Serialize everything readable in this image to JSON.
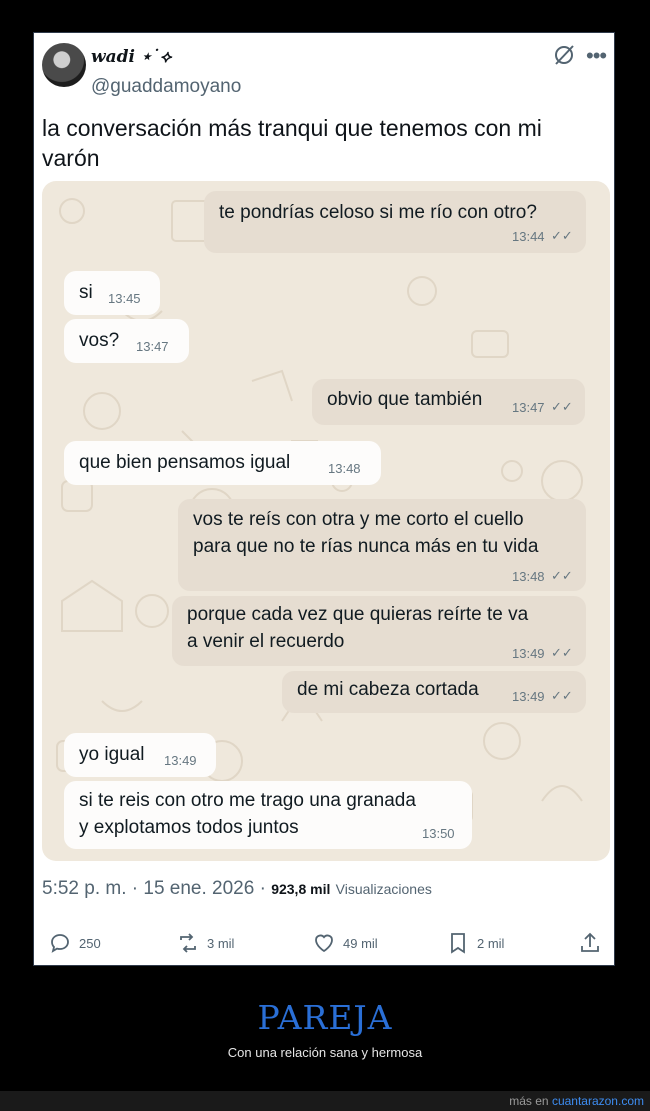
{
  "tweet": {
    "display_name": "wadi ⋆˙⟡",
    "handle": "@guaddamoyano",
    "text": "la conversación más tranqui que tenemos con mi varón",
    "timestamp": "5:52 p. m. · 15 ene. 2026 ·",
    "views_count": "923,8 mil",
    "views_label": "Visualizaciones",
    "replies": "250",
    "retweets": "3 mil",
    "likes": "49 mil",
    "bookmarks": "2 mil"
  },
  "chat": {
    "messages": [
      {
        "dir": "out",
        "text": "te pondrías celoso si me río con otro?",
        "time": "13:44",
        "ticks": "✓✓"
      },
      {
        "dir": "in",
        "text": "si",
        "time": "13:45"
      },
      {
        "dir": "in",
        "text": "vos?",
        "time": "13:47"
      },
      {
        "dir": "out",
        "text": "obvio que también",
        "time": "13:47",
        "ticks": "✓✓"
      },
      {
        "dir": "in",
        "text": "que bien pensamos igual",
        "time": "13:48"
      },
      {
        "dir": "out",
        "lines": [
          "vos te reís con otra y me corto el cuello",
          "para que no te rías nunca más en tu vida"
        ],
        "time": "13:48",
        "ticks": "✓✓"
      },
      {
        "dir": "out",
        "lines": [
          "porque cada vez que quieras reírte te va",
          "a venir el recuerdo"
        ],
        "time": "13:49",
        "ticks": "✓✓"
      },
      {
        "dir": "out",
        "text": "de mi cabeza cortada",
        "time": "13:49",
        "ticks": "✓✓"
      },
      {
        "dir": "in",
        "text": "yo igual",
        "time": "13:49"
      },
      {
        "dir": "in",
        "lines": [
          "si te reis con otro me trago una granada",
          "y explotamos todos juntos"
        ],
        "time": "13:50"
      }
    ]
  },
  "site": {
    "title": "PAREJA",
    "subtitle": "Con una relación sana y hermosa",
    "footer_prefix": "más en",
    "footer_site": "cuantarazon.com"
  },
  "colors": {
    "chat_background": "#efe8dc",
    "outgoing_bubble": "#e6ddd1",
    "incoming_bubble": "#fdfcfb",
    "title_blue": "#2a6fd6",
    "link_blue": "#3d8cf0"
  },
  "icons": [
    "grok-icon",
    "more-icon",
    "reply-icon",
    "retweet-icon",
    "like-icon",
    "bookmark-icon",
    "share-icon",
    "double-check-icon"
  ]
}
